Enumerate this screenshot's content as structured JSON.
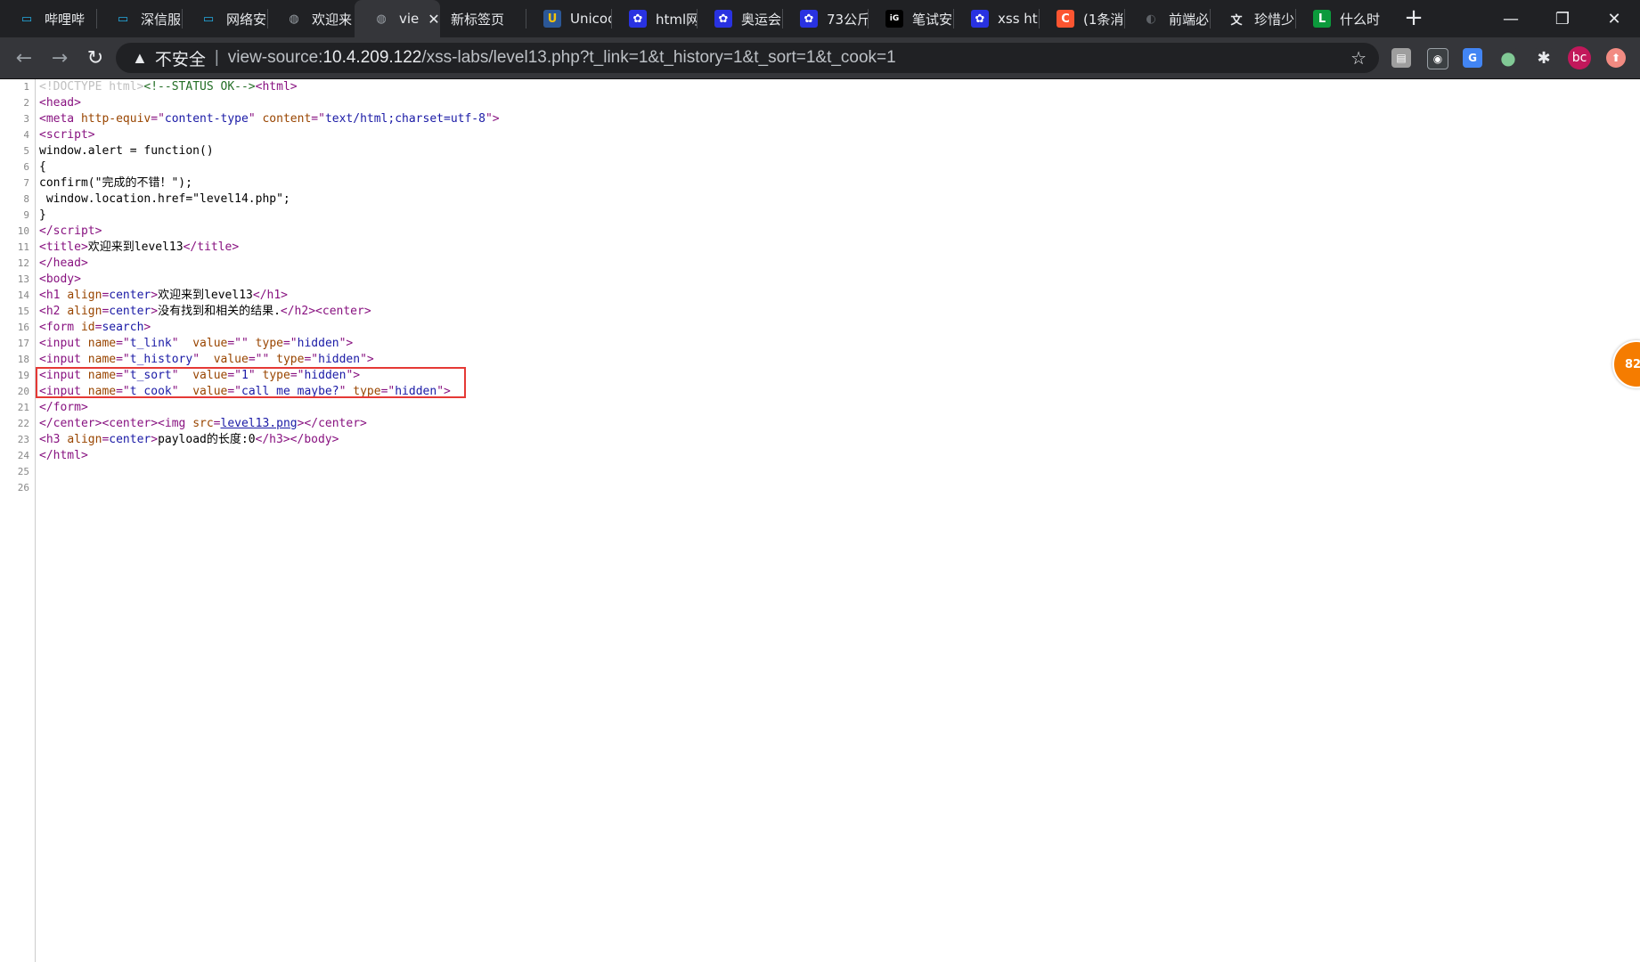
{
  "tabs": [
    {
      "label": "哔哩哔",
      "icon": "bilibili-icon"
    },
    {
      "label": "深信服",
      "icon": "bilibili-icon"
    },
    {
      "label": "网络安",
      "icon": "bilibili-icon"
    },
    {
      "label": "欢迎来",
      "icon": "globe-icon"
    },
    {
      "label": "vie",
      "icon": "globe-icon",
      "active": true
    },
    {
      "label": "新标签页",
      "icon": ""
    },
    {
      "label": "Unicoc",
      "icon": "unicode-icon"
    },
    {
      "label": "html网",
      "icon": "baidu-icon"
    },
    {
      "label": "奥运会",
      "icon": "baidu-icon"
    },
    {
      "label": "73公斤",
      "icon": "baidu-icon"
    },
    {
      "label": "笔试安",
      "icon": "dark-site-icon"
    },
    {
      "label": "xss htr",
      "icon": "baidu-icon"
    },
    {
      "label": "(1条消",
      "icon": "csdn-icon"
    },
    {
      "label": "前端必",
      "icon": "github-icon"
    },
    {
      "label": "珍惜少",
      "icon": "translate-icon"
    },
    {
      "label": "什么时",
      "icon": "green-l-icon"
    }
  ],
  "window": {
    "minimize": "—",
    "restore": "❐",
    "close": "✕"
  },
  "toolbar": {
    "insecure_label": "不安全",
    "url_prefix": "view-source:",
    "url_host": "10.4.209.122",
    "url_path": "/xss-labs/level13.php?t_link=1&t_history=1&t_sort=1&t_cook=1"
  },
  "extensions": [
    {
      "name": "pdf-extension-icon",
      "glyph": "▤",
      "color": "#5f6368"
    },
    {
      "name": "reader-extension-icon",
      "glyph": "◉",
      "color": "#5f6368"
    },
    {
      "name": "translate-extension-icon",
      "glyph": "G",
      "color": "#4285f4"
    },
    {
      "name": "green-dot-extension-icon",
      "glyph": "●",
      "color": "#81c995"
    },
    {
      "name": "puzzle-extensions-icon",
      "glyph": "✱",
      "color": "#5f6368"
    },
    {
      "name": "profile-avatar",
      "glyph": "bc",
      "color": "#c2185b"
    },
    {
      "name": "update-icon",
      "glyph": "⬆",
      "color": "#f28b82"
    }
  ],
  "source_lines": [
    {
      "n": "1"
    },
    {
      "n": "2"
    },
    {
      "n": "3"
    },
    {
      "n": "4"
    },
    {
      "n": "5"
    },
    {
      "n": "6"
    },
    {
      "n": "7"
    },
    {
      "n": "8"
    },
    {
      "n": "9"
    },
    {
      "n": "10"
    },
    {
      "n": "11"
    },
    {
      "n": "12"
    },
    {
      "n": "13"
    },
    {
      "n": "14"
    },
    {
      "n": "15"
    },
    {
      "n": "16"
    },
    {
      "n": "17"
    },
    {
      "n": "18"
    },
    {
      "n": "19"
    },
    {
      "n": "20"
    },
    {
      "n": "21"
    },
    {
      "n": "22"
    },
    {
      "n": "23"
    },
    {
      "n": "24"
    },
    {
      "n": "25"
    },
    {
      "n": "26"
    }
  ],
  "source": {
    "l1_doctype": "<!DOCTYPE html>",
    "l1_comment": "<!--STATUS OK-->",
    "l5": "window.alert = function()",
    "l6": "{",
    "l7": "confirm(\"完成的不错！\");",
    "l8": " window.location.href=\"level14.php\";",
    "l9": "}",
    "l11_text": "欢迎来到level13",
    "l14_text": "欢迎来到level13",
    "l15_text": "没有找到和相关的结果.",
    "l22_link": "level13.png",
    "l23_text": "payload的长度:0"
  },
  "badge": {
    "text": "82"
  }
}
